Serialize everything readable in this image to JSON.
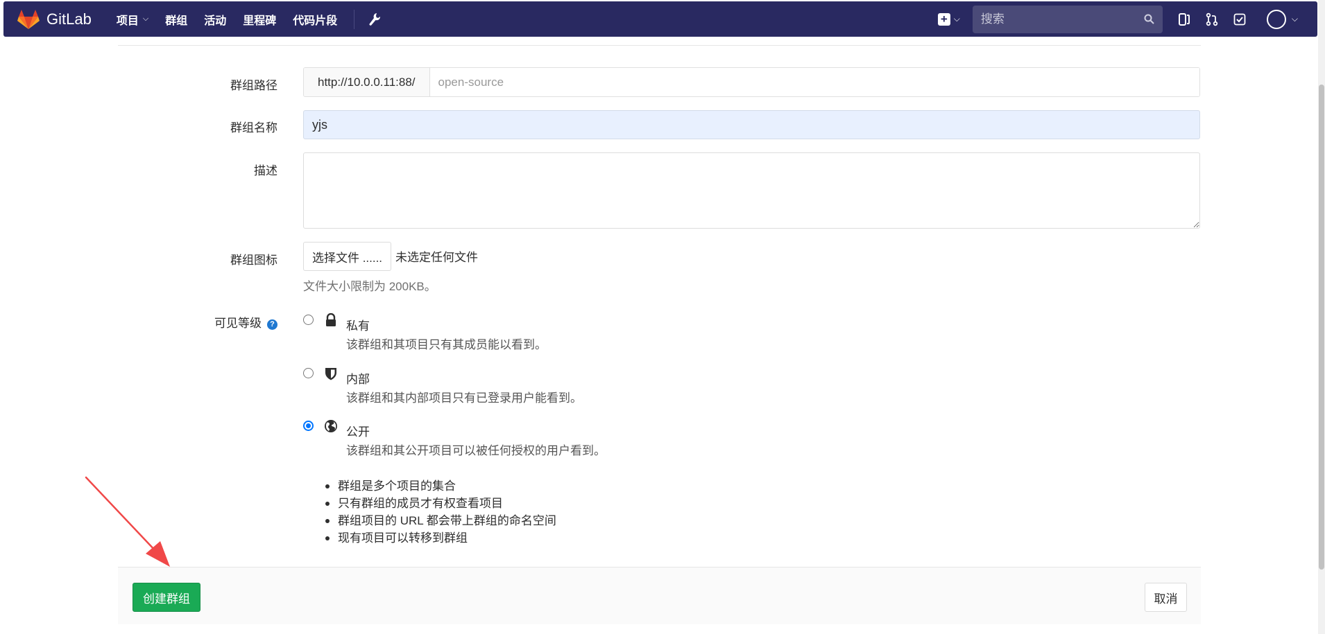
{
  "navbar": {
    "brand": "GitLab",
    "items": [
      {
        "label": "项目",
        "has_caret": true
      },
      {
        "label": "群组"
      },
      {
        "label": "活动"
      },
      {
        "label": "里程碑"
      },
      {
        "label": "代码片段"
      }
    ],
    "search_placeholder": "搜索"
  },
  "form": {
    "path_label": "群组路径",
    "path_prefix": "http://10.0.0.11:88/",
    "path_placeholder": "open-source",
    "name_label": "群组名称",
    "name_value": "yjs",
    "description_label": "描述",
    "description_value": "",
    "avatar_label": "群组图标",
    "file_button": "选择文件 ......",
    "file_status": "未选定任何文件",
    "file_help": "文件大小限制为 200KB。",
    "visibility_label": "可见等级",
    "visibility_options": [
      {
        "title": "私有",
        "desc": "该群组和其项目只有其成员能以看到。",
        "icon": "lock-icon",
        "selected": false
      },
      {
        "title": "内部",
        "desc": "该群组和其内部项目只有已登录用户能看到。",
        "icon": "shield-icon",
        "selected": false
      },
      {
        "title": "公开",
        "desc": "该群组和其公开项目可以被任何授权的用户看到。",
        "icon": "globe-icon",
        "selected": true
      }
    ],
    "info_bullets": [
      "群组是多个项目的集合",
      "只有群组的成员才有权查看项目",
      "群组项目的 URL 都会带上群组的命名空间",
      "现有项目可以转移到群组"
    ]
  },
  "actions": {
    "create_label": "创建群组",
    "cancel_label": "取消"
  },
  "colors": {
    "navbar_bg": "#292961",
    "create_button": "#1aaa55",
    "annotation_arrow": "#f04848"
  }
}
